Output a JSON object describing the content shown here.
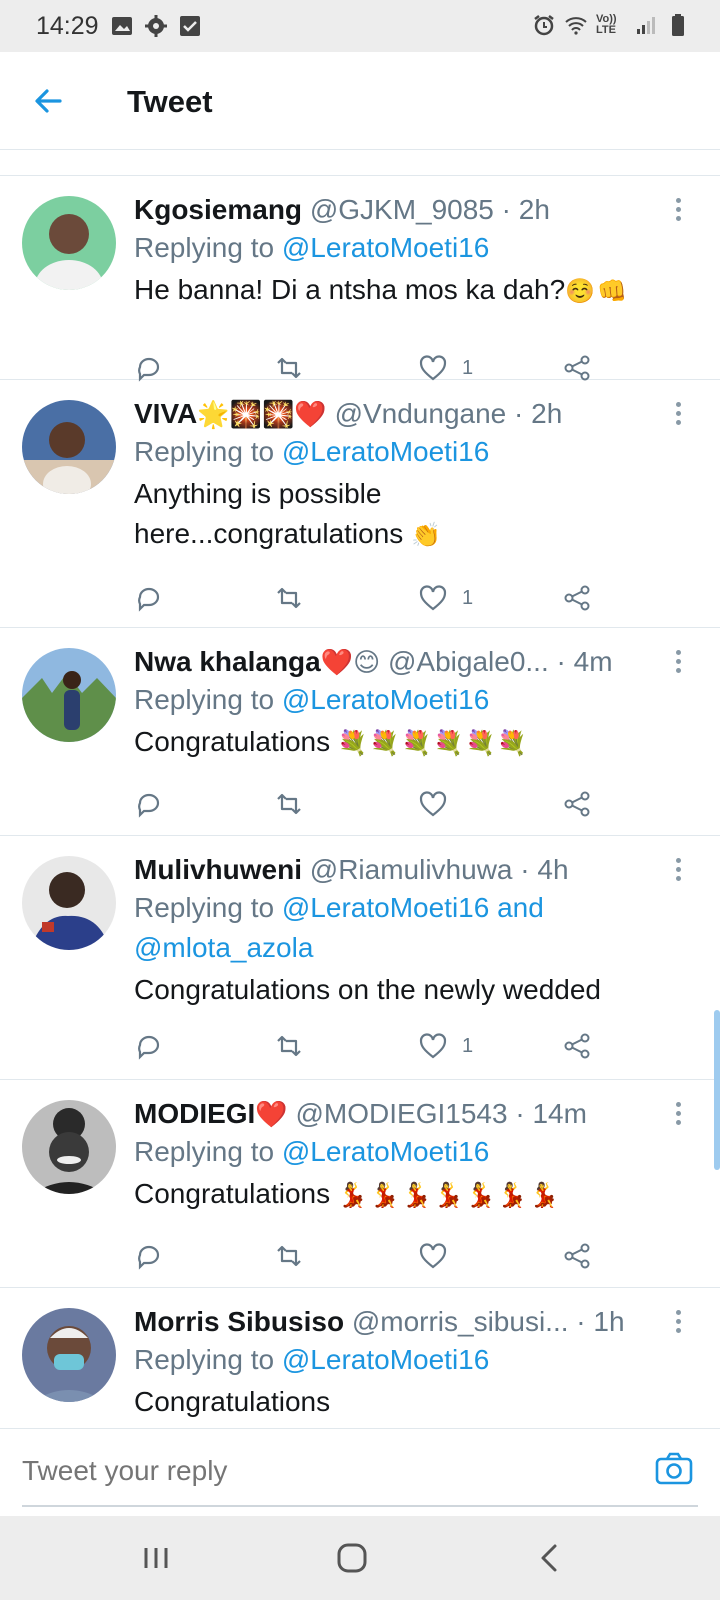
{
  "status_bar": {
    "time": "14:29",
    "left_icons": [
      "image-icon",
      "gear-icon",
      "checkbox-icon"
    ],
    "right_icons": [
      "alarm-icon",
      "wifi-icon",
      "volte-icon",
      "signal-icon",
      "battery-icon"
    ],
    "volte_label": "Vo)) LTE"
  },
  "header": {
    "title": "Tweet",
    "back_icon": "arrow-left-icon"
  },
  "colors": {
    "accent": "#1b95e0",
    "secondary_text": "#657786",
    "primary_text": "#14171a"
  },
  "tweets": [
    {
      "name": "Kgosiemang",
      "name_emoji": "",
      "handle": "@GJKM_9085",
      "time": "· 2h",
      "replying_prefix": "Replying to ",
      "mention": "@LeratoMoeti16",
      "mention_extra": "",
      "text": "He banna! Di a ntsha mos ka dah?",
      "text_emoji": "☺️👊",
      "likes": "1",
      "avatar_bg": "#7ccfa0",
      "avatar_fg": "#6b4a3a"
    },
    {
      "name": "VIVA",
      "name_emoji": "🌟🎇🎇❤️",
      "handle": "@Vndungane",
      "time": "· 2h",
      "replying_prefix": "Replying to ",
      "mention": "@LeratoMoeti16",
      "mention_extra": "",
      "text": "Anything is possible here...congratulations",
      "text_emoji": "👏",
      "likes": "1",
      "avatar_bg": "#4a6fa5",
      "avatar_fg": "#5a3a2a"
    },
    {
      "name": "Nwa khalanga",
      "name_emoji": "❤️😊",
      "handle": "@Abigale0...",
      "time": "· 4m",
      "replying_prefix": "Replying to ",
      "mention": "@LeratoMoeti16",
      "mention_extra": "",
      "text": "Congratulations",
      "text_emoji": "💐💐💐💐💐💐",
      "likes": "",
      "avatar_bg": "#8fb8e0",
      "avatar_fg": "#2b3f6e"
    },
    {
      "name": "Mulivhuweni",
      "name_emoji": "",
      "handle": "@Riamulivhuwa",
      "time": "· 4h",
      "replying_prefix": "Replying to ",
      "mention": "@LeratoMoeti16 and",
      "mention_extra": "@mlota_azola",
      "text": "Congratulations on the newly wedded",
      "text_emoji": "",
      "likes": "1",
      "avatar_bg": "#e8e8e8",
      "avatar_fg": "#3a2a22"
    },
    {
      "name": "MODIEGI",
      "name_emoji": "❤️",
      "handle": "@MODIEGI1543",
      "time": "· 14m",
      "replying_prefix": "Replying to ",
      "mention": "@LeratoMoeti16",
      "mention_extra": "",
      "text": "Congratulations",
      "text_emoji": "💃💃💃💃💃💃💃",
      "likes": "",
      "avatar_bg": "#bdbdbd",
      "avatar_fg": "#2a2a2a"
    },
    {
      "name": "Morris Sibusiso",
      "name_emoji": "",
      "handle": "@morris_sibusi...",
      "time": "· 1h",
      "replying_prefix": "Replying to ",
      "mention": "@LeratoMoeti16",
      "mention_extra": "",
      "text": "Congratulations",
      "text_emoji": "",
      "likes": "",
      "avatar_bg": "#6a7aa0",
      "avatar_fg": "#6ec6d8"
    }
  ],
  "reply_bar": {
    "placeholder": "Tweet your reply",
    "camera_icon": "camera-icon"
  },
  "nav_bar": {
    "buttons": [
      "recent-apps-button",
      "home-button",
      "back-nav-button"
    ]
  }
}
